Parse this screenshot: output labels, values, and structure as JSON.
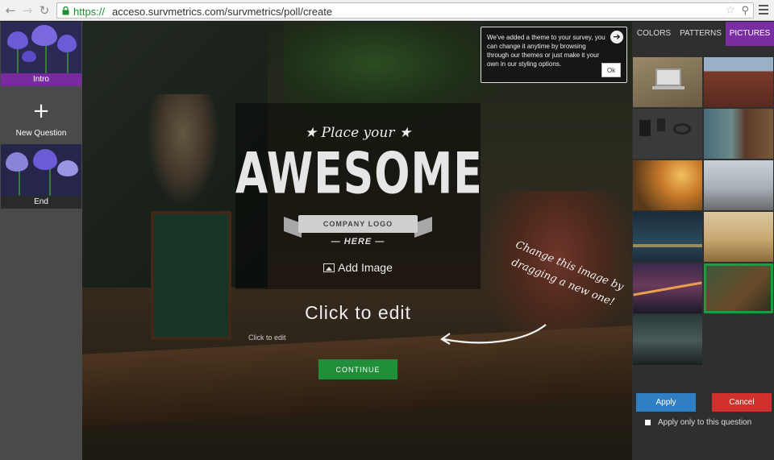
{
  "browser": {
    "url_scheme": "https://",
    "url_rest": "acceso.survmetrics.com/survmetrics/poll/create",
    "back_icon": "←",
    "forward_icon": "→",
    "reload_icon": "↻"
  },
  "sidebar": {
    "slides": [
      {
        "label": "Intro"
      },
      {
        "label": "End"
      }
    ],
    "add_symbol": "+",
    "new_question_label": "New Question"
  },
  "canvas": {
    "logo": {
      "top_text": "★ Place your ★",
      "main_text": "AWESOME",
      "ribbon_text": "COMPANY LOGO",
      "bottom_text": "— HERE —"
    },
    "add_image_label": "Add Image",
    "title_placeholder": "Click to edit",
    "subtitle_placeholder": "Click to edit",
    "continue_label": "CONTINUE",
    "hand_note": "Change this image by dragging a new one!"
  },
  "tooltip": {
    "text": "We've added a theme to your survey, you can change it anytime by browsing through our themes or just make it your own in our styling options.",
    "arrow_symbol": "➔",
    "ok_label": "Ok"
  },
  "panel": {
    "tabs": [
      {
        "label": "COLORS",
        "active": false
      },
      {
        "label": "PATTERNS",
        "active": false
      },
      {
        "label": "PICTURES",
        "active": true
      }
    ],
    "apply_label": "Apply",
    "cancel_label": "Cancel",
    "apply_only_label": "Apply only to this question"
  },
  "colors": {
    "accent_purple": "#7b2ea3",
    "continue_green": "#1f8f3a",
    "apply_blue": "#2f7fc4",
    "cancel_red": "#d0312d",
    "selected_outline": "#1f9a43"
  }
}
